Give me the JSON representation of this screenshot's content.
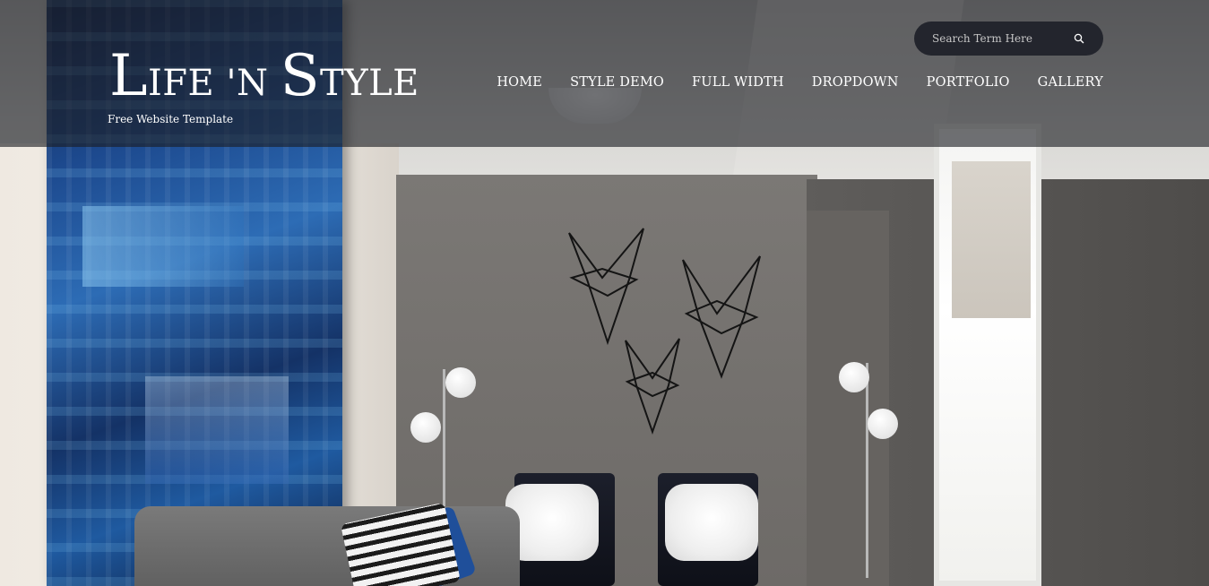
{
  "site": {
    "title_parts": [
      {
        "text": "L",
        "big": true
      },
      {
        "text": "IFE 'N ",
        "big": false
      },
      {
        "text": "S",
        "big": true
      },
      {
        "text": "TYLE",
        "big": false
      }
    ],
    "tagline": "Free Website Template"
  },
  "search": {
    "placeholder": "Search Term Here",
    "value": "",
    "icon": "search-icon"
  },
  "nav": {
    "items": [
      {
        "label": "HOME"
      },
      {
        "label": "STYLE DEMO"
      },
      {
        "label": "FULL WIDTH"
      },
      {
        "label": "DROPDOWN"
      },
      {
        "label": "PORTFOLIO"
      },
      {
        "label": "GALLERY"
      }
    ]
  },
  "colors": {
    "header_overlay": "#1c1d22",
    "search_bg": "#23252d",
    "text": "#ffffff"
  }
}
